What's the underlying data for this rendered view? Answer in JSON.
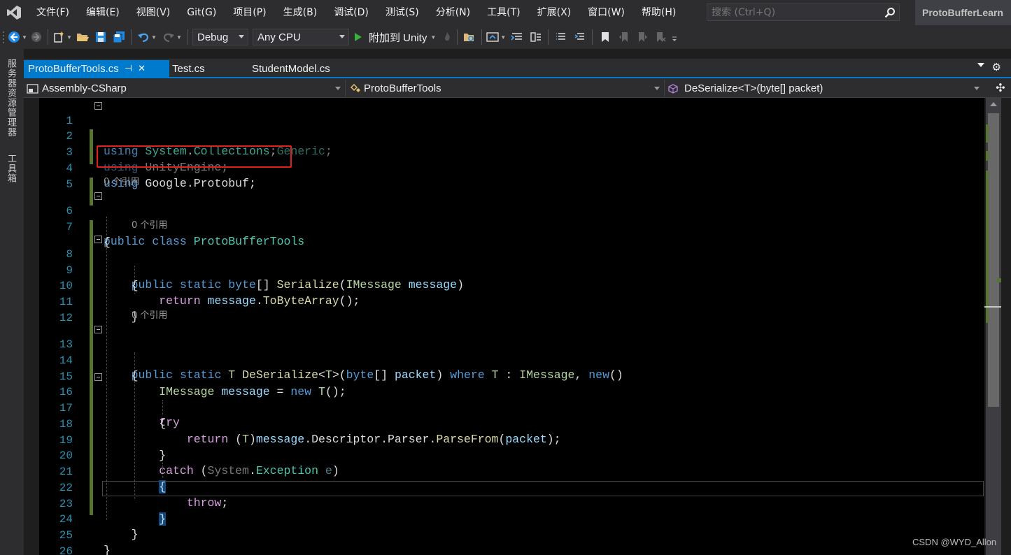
{
  "menubar": {
    "items": [
      "文件(F)",
      "编辑(E)",
      "视图(V)",
      "Git(G)",
      "项目(P)",
      "生成(B)",
      "调试(D)",
      "测试(S)",
      "分析(N)",
      "工具(T)",
      "扩展(X)",
      "窗口(W)",
      "帮助(H)"
    ],
    "search_placeholder": "搜索 (Ctrl+Q)",
    "solution_name": "ProtoBufferLearn"
  },
  "toolbar": {
    "configuration": "Debug",
    "platform": "Any CPU",
    "attach_label": "附加到 Unity"
  },
  "side_panels": [
    "服务器资源管理器",
    "工具箱"
  ],
  "tabs": [
    {
      "label": "ProtoBufferTools.cs",
      "active": true
    },
    {
      "label": "Test.cs",
      "active": false
    },
    {
      "label": "StudentModel.cs",
      "active": false
    }
  ],
  "navbar": {
    "project": "Assembly-CSharp",
    "type": "ProtoBufferTools",
    "member": "DeSerialize<T>(byte[] packet)"
  },
  "editor": {
    "codelens_refs": "0 个引用",
    "lines": [
      {
        "n": "1",
        "t": "using System.Collections;"
      },
      {
        "n": "2",
        "t": "using System.Collections.Generic;"
      },
      {
        "n": "3",
        "t": "using UnityEngine;"
      },
      {
        "n": "4",
        "t": "using Google.Protobuf;"
      },
      {
        "n": "5",
        "t": ""
      },
      {
        "n": "6",
        "t": "public class ProtoBufferTools"
      },
      {
        "n": "7",
        "t": "{"
      },
      {
        "n": "8",
        "t": "    public static byte[] Serialize(IMessage message)"
      },
      {
        "n": "9",
        "t": "    {"
      },
      {
        "n": "10",
        "t": "        return message.ToByteArray();"
      },
      {
        "n": "11",
        "t": "    }"
      },
      {
        "n": "12",
        "t": ""
      },
      {
        "n": "13",
        "t": "    public static T DeSerialize<T>(byte[] packet) where T : IMessage, new()"
      },
      {
        "n": "14",
        "t": "    {"
      },
      {
        "n": "15",
        "t": "        IMessage message = new T();"
      },
      {
        "n": "16",
        "t": "        try"
      },
      {
        "n": "17",
        "t": "        {"
      },
      {
        "n": "18",
        "t": "            return (T)message.Descriptor.Parser.ParseFrom(packet);"
      },
      {
        "n": "19",
        "t": "        }"
      },
      {
        "n": "20",
        "t": "        catch (System.Exception e)"
      },
      {
        "n": "21",
        "t": "        {"
      },
      {
        "n": "22",
        "t": "            throw;"
      },
      {
        "n": "23",
        "t": "        }"
      },
      {
        "n": "24",
        "t": "    }"
      },
      {
        "n": "25",
        "t": "}"
      },
      {
        "n": "26",
        "t": ""
      }
    ]
  },
  "watermark": "CSDN @WYD_Allon",
  "colors": {
    "accent": "#007acc",
    "keyword": "#569cd6",
    "control_keyword": "#d8a0df",
    "type": "#4ec9b0",
    "method": "#dcdcaa",
    "parameter": "#9cdcfe",
    "highlight_box": "#e01f1f"
  }
}
